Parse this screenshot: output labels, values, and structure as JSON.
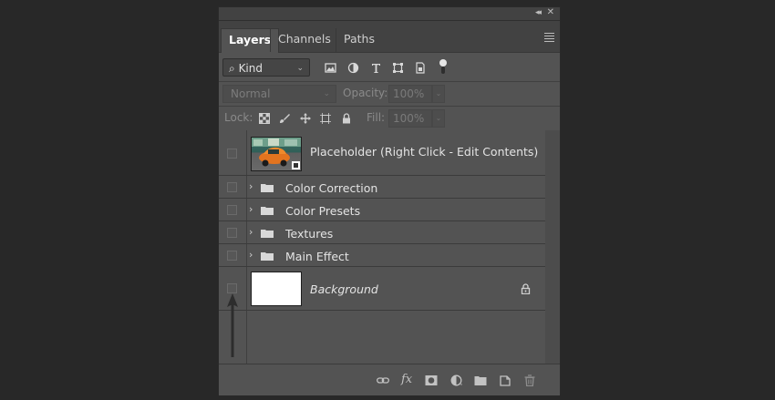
{
  "panel": {
    "tabs": [
      {
        "label": "Layers",
        "active": true
      },
      {
        "label": "Channels",
        "active": false
      },
      {
        "label": "Paths",
        "active": false
      }
    ]
  },
  "filter": {
    "kind_label": "Kind",
    "icons": [
      "pixel-layer-filter-icon",
      "adjustment-layer-filter-icon",
      "type-layer-filter-icon",
      "shape-layer-filter-icon",
      "smart-object-filter-icon"
    ]
  },
  "blend": {
    "mode": "Normal",
    "opacity_label": "Opacity:",
    "opacity_value": "100%",
    "lock_label": "Lock:",
    "fill_label": "Fill:",
    "fill_value": "100%"
  },
  "layers": [
    {
      "name": "Placeholder (Right Click - Edit Contents)",
      "type": "smart-object"
    },
    {
      "name": "Color Correction",
      "type": "group"
    },
    {
      "name": "Color Presets",
      "type": "group"
    },
    {
      "name": "Textures",
      "type": "group"
    },
    {
      "name": "Main Effect",
      "type": "group"
    },
    {
      "name": "Background",
      "type": "background",
      "locked": true
    }
  ],
  "footer_icons": [
    "link-layers-icon",
    "fx-icon",
    "add-mask-icon",
    "adjustment-layer-icon",
    "new-group-icon",
    "new-layer-icon",
    "delete-layer-icon"
  ],
  "colors": {
    "panel_bg": "#535353",
    "page_bg": "#282828",
    "tab_bar": "#424242"
  }
}
